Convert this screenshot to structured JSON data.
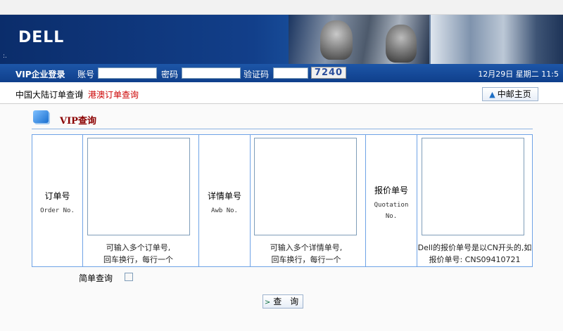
{
  "banner": {
    "logo": "DELL",
    "dots": ":."
  },
  "login": {
    "title": "VIP企业登录",
    "account_label": "账号",
    "password_label": "密码",
    "captcha_label": "验证码",
    "captcha_text": "7240",
    "datetime": "12月29日 星期二 11:5"
  },
  "nav": {
    "mainland": "中国大陆订单查询",
    "separator": "|",
    "hongkong": "港澳订单查询",
    "home": "中邮主页"
  },
  "section": {
    "title": "VIP查询"
  },
  "query": {
    "order": {
      "label": "订单号",
      "label_en": "Order No.",
      "hint1": "可输入多个订单号,",
      "hint2": "回车换行，每行一个"
    },
    "awb": {
      "label": "详情单号",
      "label_en": "Awb No.",
      "hint1": "可输入多个详情单号,",
      "hint2": "回车换行，每行一个"
    },
    "quotation": {
      "label": "报价单号",
      "label_en1": "Quotation",
      "label_en2": "No.",
      "hint1": "Dell的报价单号是以CN开头的,如",
      "hint2": "报价单号: CNS09410721"
    }
  },
  "simple_query": "简单查询",
  "submit": "查 询"
}
